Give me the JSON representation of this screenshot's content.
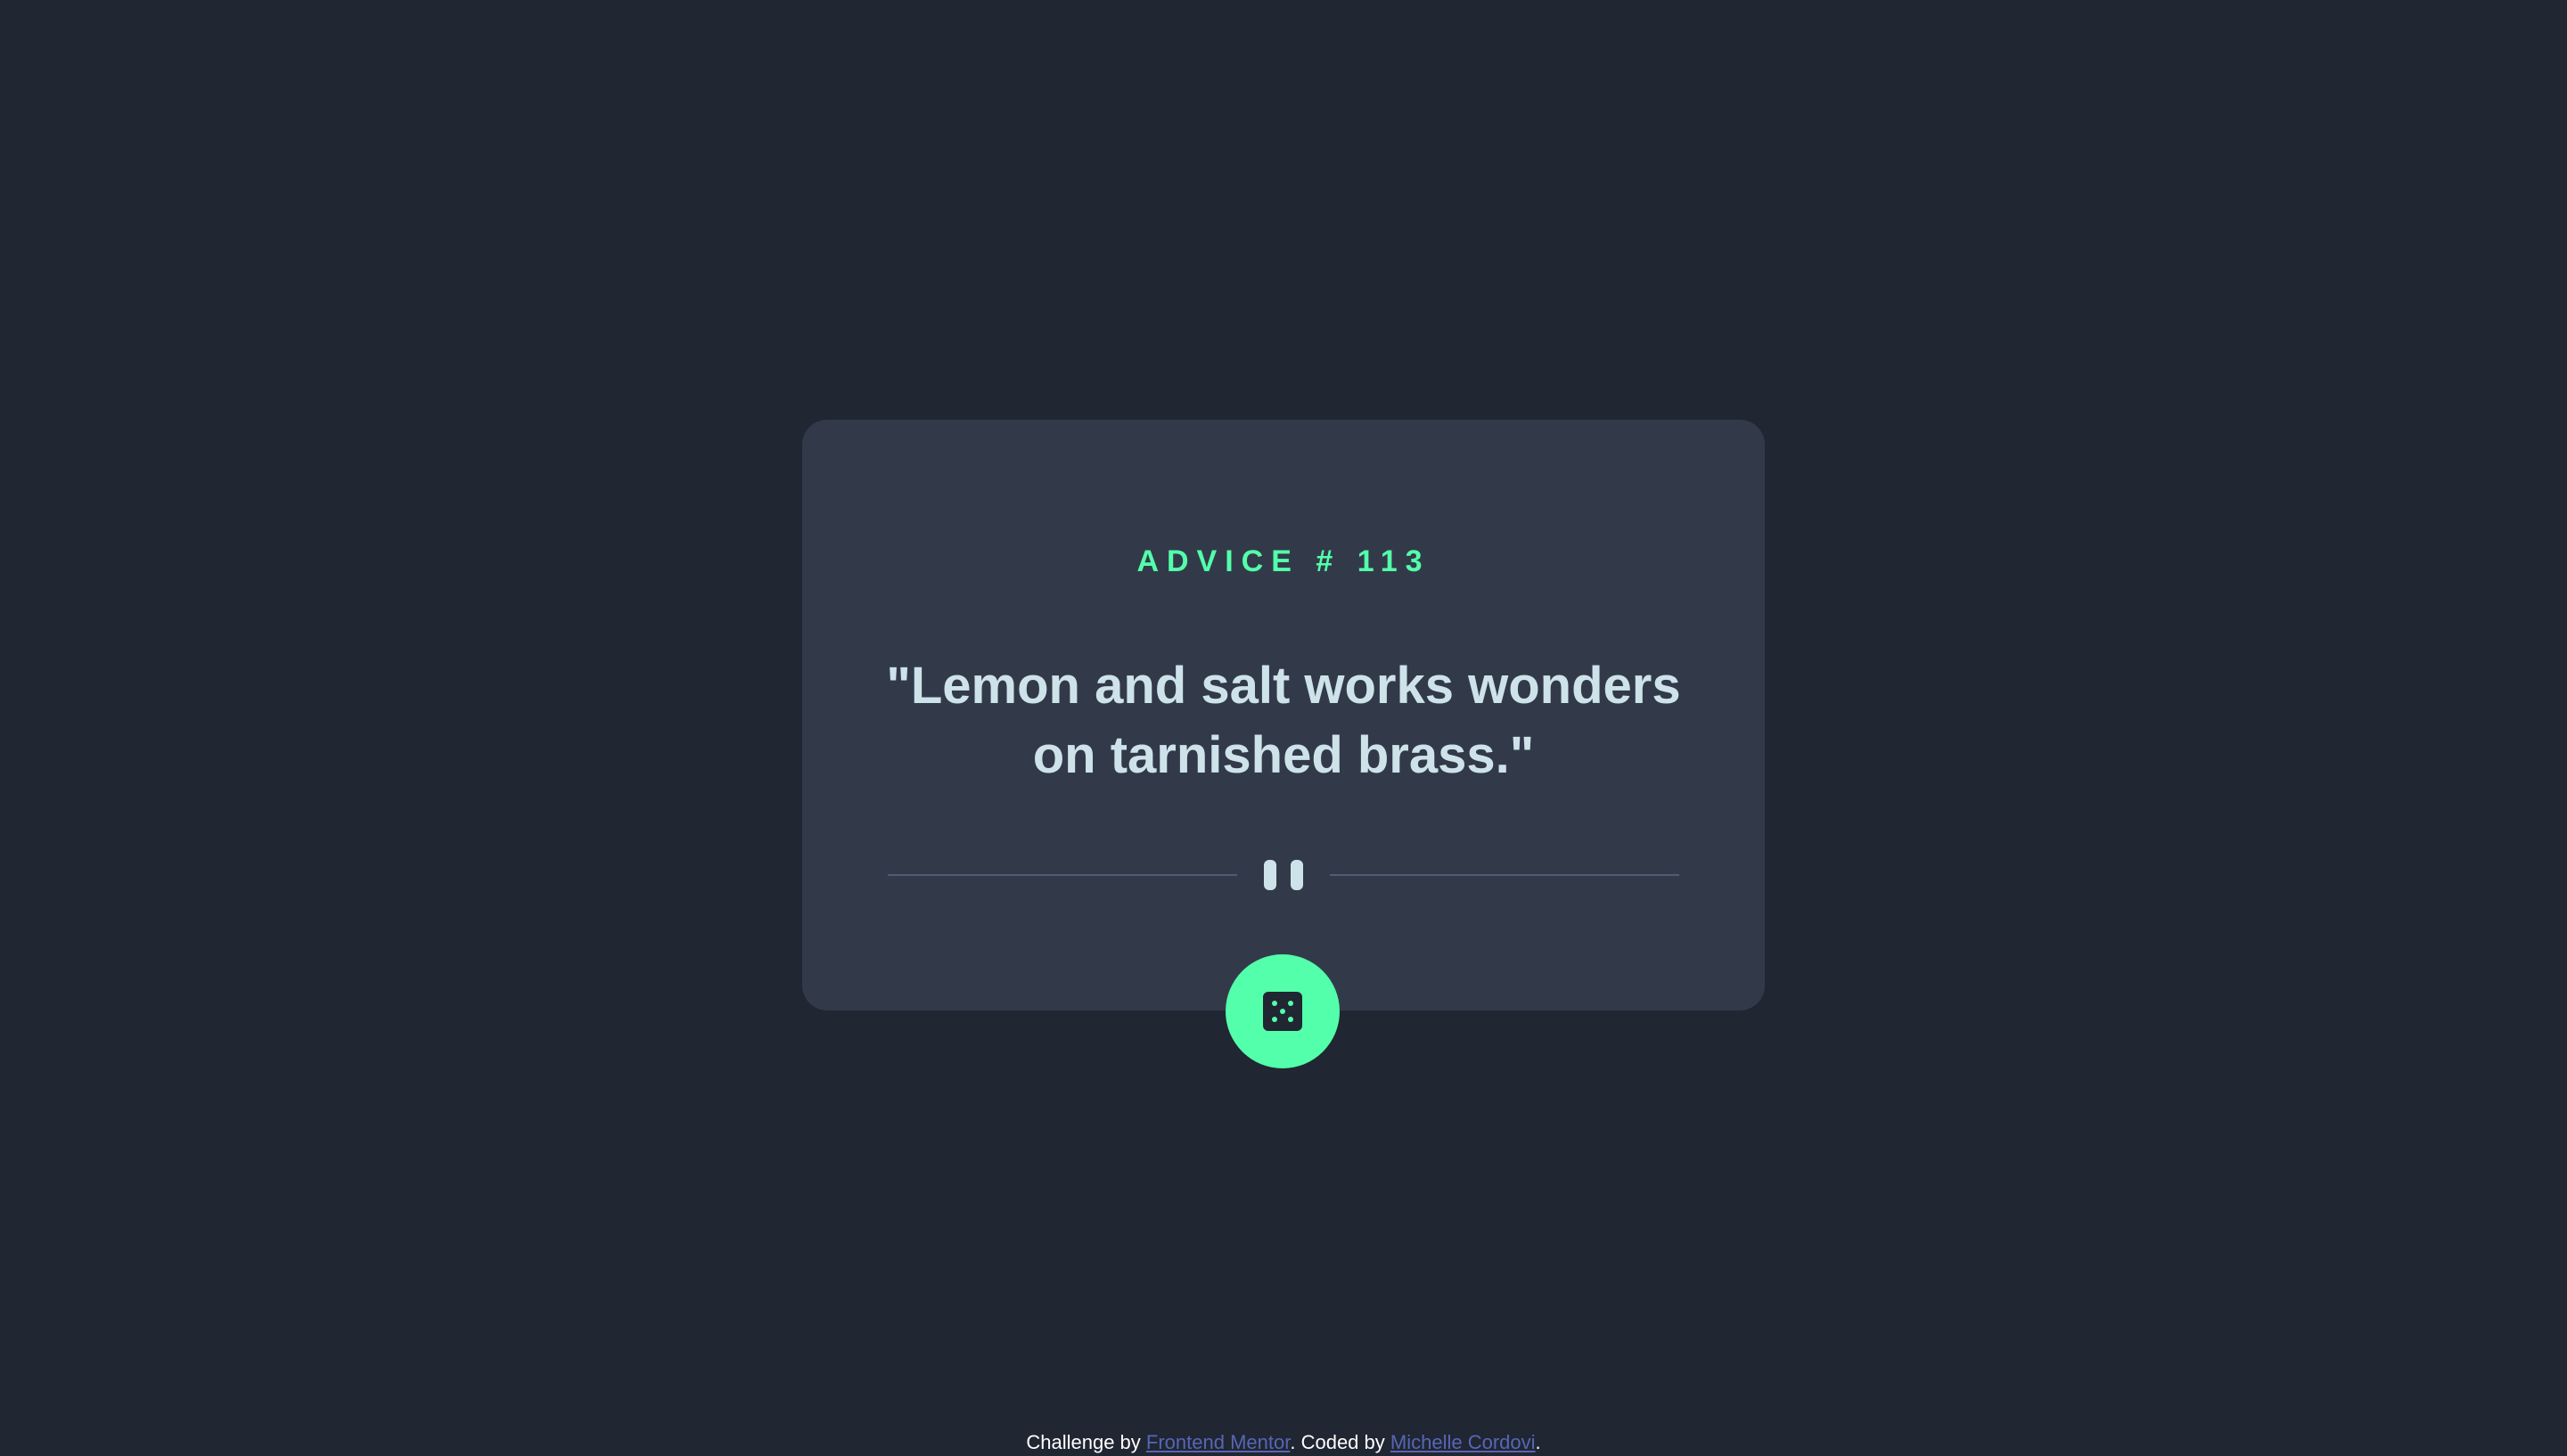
{
  "card": {
    "advice_label": "ADVICE # 113",
    "advice_text": "\"Lemon and salt works wonders on tarnished brass.\""
  },
  "divider": {
    "icon": "pause-icon"
  },
  "dice_button": {
    "icon": "dice-icon"
  },
  "footer": {
    "prefix": "Challenge by",
    "challenge_link": "Frontend Mentor",
    "middle": ". Coded by",
    "author_link": "Michelle Cordovi",
    "suffix": "."
  },
  "colors": {
    "background": "#202632",
    "card": "#323a4a",
    "accent": "#53ffaa",
    "text": "#cee3e9",
    "divider": "#4e5d73",
    "link": "#5766b5"
  }
}
